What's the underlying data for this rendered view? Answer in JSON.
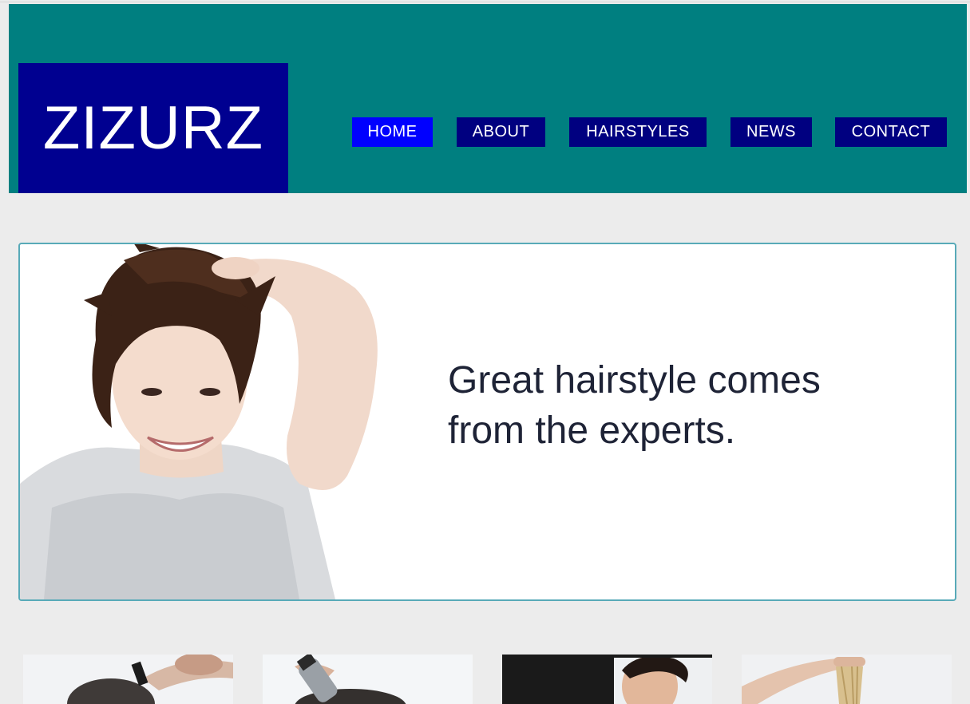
{
  "header": {
    "logo_text": "ZIZURZ",
    "background": "#007f80",
    "logo_background": "#000090"
  },
  "nav": {
    "items": [
      {
        "label": "HOME",
        "active": true
      },
      {
        "label": "ABOUT",
        "active": false
      },
      {
        "label": "HAIRSTYLES",
        "active": false
      },
      {
        "label": "NEWS",
        "active": false
      },
      {
        "label": "CONTACT",
        "active": false
      }
    ],
    "active_color": "#0000ff",
    "color": "#000080"
  },
  "hero": {
    "line1": "Great hairstyle comes",
    "line2": "from the experts."
  },
  "thumbnails": [
    {
      "subject": "barber-cutting-hair"
    },
    {
      "subject": "clipper-trim"
    },
    {
      "subject": "stylist-portrait"
    },
    {
      "subject": "blonde-hair-lengths"
    }
  ]
}
